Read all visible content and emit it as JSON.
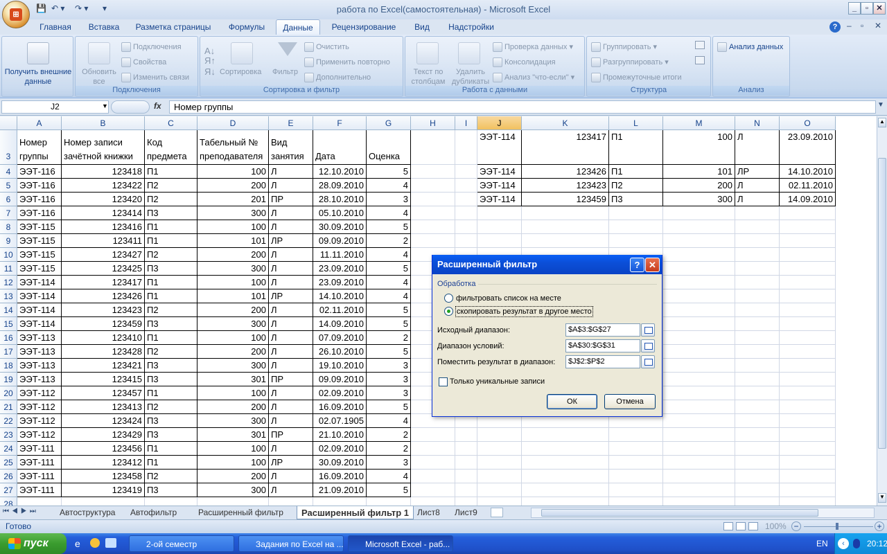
{
  "window": {
    "title": "работа по Excel(самостоятельная) - Microsoft Excel"
  },
  "tabs": [
    "Главная",
    "Вставка",
    "Разметка страницы",
    "Формулы",
    "Данные",
    "Рецензирование",
    "Вид",
    "Надстройки"
  ],
  "active_tab": "Данные",
  "ribbon": {
    "get_external": "Получить внешние данные",
    "refresh_all": "Обновить все",
    "connections": "Подключения",
    "properties": "Свойства",
    "edit_links": "Изменить связи",
    "group_connections": "Подключения",
    "sort": "Сортировка",
    "filter": "Фильтр",
    "clear": "Очистить",
    "reapply": "Применить повторно",
    "advanced": "Дополнительно",
    "group_sort_filter": "Сортировка и фильтр",
    "text_to_columns": "Текст по столбцам",
    "remove_duplicates": "Удалить дубликаты",
    "data_validation": "Проверка данных",
    "consolidation": "Консолидация",
    "whatif": "Анализ \"что-если\"",
    "group_data_tools": "Работа с данными",
    "group": "Группировать",
    "ungroup": "Разгруппировать",
    "subtotal": "Промежуточные итоги",
    "group_outline": "Структура",
    "data_analysis": "Анализ данных",
    "group_analysis": "Анализ"
  },
  "formula_bar": {
    "name_box": "J2",
    "fx": "fx",
    "formula": "Номер группы"
  },
  "columns": [
    "A",
    "B",
    "C",
    "D",
    "E",
    "F",
    "G",
    "H",
    "I",
    "J",
    "K",
    "L",
    "M",
    "N",
    "O"
  ],
  "selected_column": "J",
  "row_numbers": [
    "3",
    "4",
    "5",
    "6",
    "7",
    "8",
    "9",
    "10",
    "11",
    "12",
    "13",
    "14",
    "15",
    "16",
    "17",
    "18",
    "19",
    "20",
    "21",
    "22",
    "23",
    "24",
    "25",
    "26",
    "27",
    "28"
  ],
  "header": {
    "a1": "Номер",
    "a2": "группы",
    "b1": "Номер записи",
    "b2": "зачётной книжки",
    "c1": "Код",
    "c2": "предмета",
    "d1": "Табельный №",
    "d2": "преподавателя",
    "e1": "Вид",
    "e2": "занятия",
    "f": "Дата",
    "g": "Оценка"
  },
  "rows": [
    [
      "ЭЭТ-116",
      "123418",
      "П1",
      "100",
      "Л",
      "12.10.2010",
      "5"
    ],
    [
      "ЭЭТ-116",
      "123422",
      "П2",
      "200",
      "Л",
      "28.09.2010",
      "4"
    ],
    [
      "ЭЭТ-116",
      "123420",
      "П2",
      "201",
      "ПР",
      "28.10.2010",
      "3"
    ],
    [
      "ЭЭТ-116",
      "123414",
      "П3",
      "300",
      "Л",
      "05.10.2010",
      "4"
    ],
    [
      "ЭЭТ-115",
      "123416",
      "П1",
      "100",
      "Л",
      "30.09.2010",
      "5"
    ],
    [
      "ЭЭТ-115",
      "123411",
      "П1",
      "101",
      "ЛР",
      "09.09.2010",
      "2"
    ],
    [
      "ЭЭТ-115",
      "123427",
      "П2",
      "200",
      "Л",
      "11.11.2010",
      "4"
    ],
    [
      "ЭЭТ-115",
      "123425",
      "П3",
      "300",
      "Л",
      "23.09.2010",
      "5"
    ],
    [
      "ЭЭТ-114",
      "123417",
      "П1",
      "100",
      "Л",
      "23.09.2010",
      "4"
    ],
    [
      "ЭЭТ-114",
      "123426",
      "П1",
      "101",
      "ЛР",
      "14.10.2010",
      "4"
    ],
    [
      "ЭЭТ-114",
      "123423",
      "П2",
      "200",
      "Л",
      "02.11.2010",
      "5"
    ],
    [
      "ЭЭТ-114",
      "123459",
      "П3",
      "300",
      "Л",
      "14.09.2010",
      "5"
    ],
    [
      "ЭЭТ-113",
      "123410",
      "П1",
      "100",
      "Л",
      "07.09.2010",
      "2"
    ],
    [
      "ЭЭТ-113",
      "123428",
      "П2",
      "200",
      "Л",
      "26.10.2010",
      "5"
    ],
    [
      "ЭЭТ-113",
      "123421",
      "П3",
      "300",
      "Л",
      "19.10.2010",
      "3"
    ],
    [
      "ЭЭТ-113",
      "123415",
      "П3",
      "301",
      "ПР",
      "09.09.2010",
      "3"
    ],
    [
      "ЭЭТ-112",
      "123457",
      "П1",
      "100",
      "Л",
      "02.09.2010",
      "3"
    ],
    [
      "ЭЭТ-112",
      "123413",
      "П2",
      "200",
      "Л",
      "16.09.2010",
      "5"
    ],
    [
      "ЭЭТ-112",
      "123424",
      "П3",
      "300",
      "Л",
      "02.07.1905",
      "4"
    ],
    [
      "ЭЭТ-112",
      "123429",
      "П3",
      "301",
      "ПР",
      "21.10.2010",
      "2"
    ],
    [
      "ЭЭТ-111",
      "123456",
      "П1",
      "100",
      "Л",
      "02.09.2010",
      "2"
    ],
    [
      "ЭЭТ-111",
      "123412",
      "П1",
      "100",
      "ЛР",
      "30.09.2010",
      "3"
    ],
    [
      "ЭЭТ-111",
      "123458",
      "П2",
      "200",
      "Л",
      "16.09.2010",
      "4"
    ],
    [
      "ЭЭТ-111",
      "123419",
      "П3",
      "300",
      "Л",
      "21.09.2010",
      "5"
    ]
  ],
  "result_rows": [
    [
      "ЭЭТ-114",
      "123417",
      "П1",
      "100",
      "Л",
      "23.09.2010"
    ],
    [
      "ЭЭТ-114",
      "123426",
      "П1",
      "101",
      "ЛР",
      "14.10.2010"
    ],
    [
      "ЭЭТ-114",
      "123423",
      "П2",
      "200",
      "Л",
      "02.11.2010"
    ],
    [
      "ЭЭТ-114",
      "123459",
      "П3",
      "300",
      "Л",
      "14.09.2010"
    ]
  ],
  "dialog": {
    "title": "Расширенный фильтр",
    "help": "?",
    "close": "✕",
    "processing": "Обработка",
    "opt_inplace": "фильтровать список на месте",
    "opt_copy": "скопировать результат в другое место",
    "selected_option": "copy",
    "source_label": "Исходный диапазон:",
    "source_value": "$A$3:$G$27",
    "criteria_label": "Диапазон условий:",
    "criteria_value": "$A$30:$G$31",
    "dest_label": "Поместить результат в диапазон:",
    "dest_value": "$J$2:$P$2",
    "unique_label": "Только уникальные записи",
    "unique_checked": false,
    "ok": "ОК",
    "cancel": "Отмена"
  },
  "sheets": [
    "Автоструктура",
    "Автофильтр",
    "Расширенный фильтр",
    "Расширенный фильтр 1",
    "Лист8",
    "Лист9"
  ],
  "active_sheet": "Расширенный фильтр 1",
  "status": {
    "ready": "Готово",
    "zoom": "100%"
  },
  "taskbar": {
    "start": "пуск",
    "items": [
      "2-ой семестр",
      "Задания по Excel на ...",
      "Microsoft Excel - раб..."
    ],
    "lang": "EN",
    "clock": "20:12"
  }
}
